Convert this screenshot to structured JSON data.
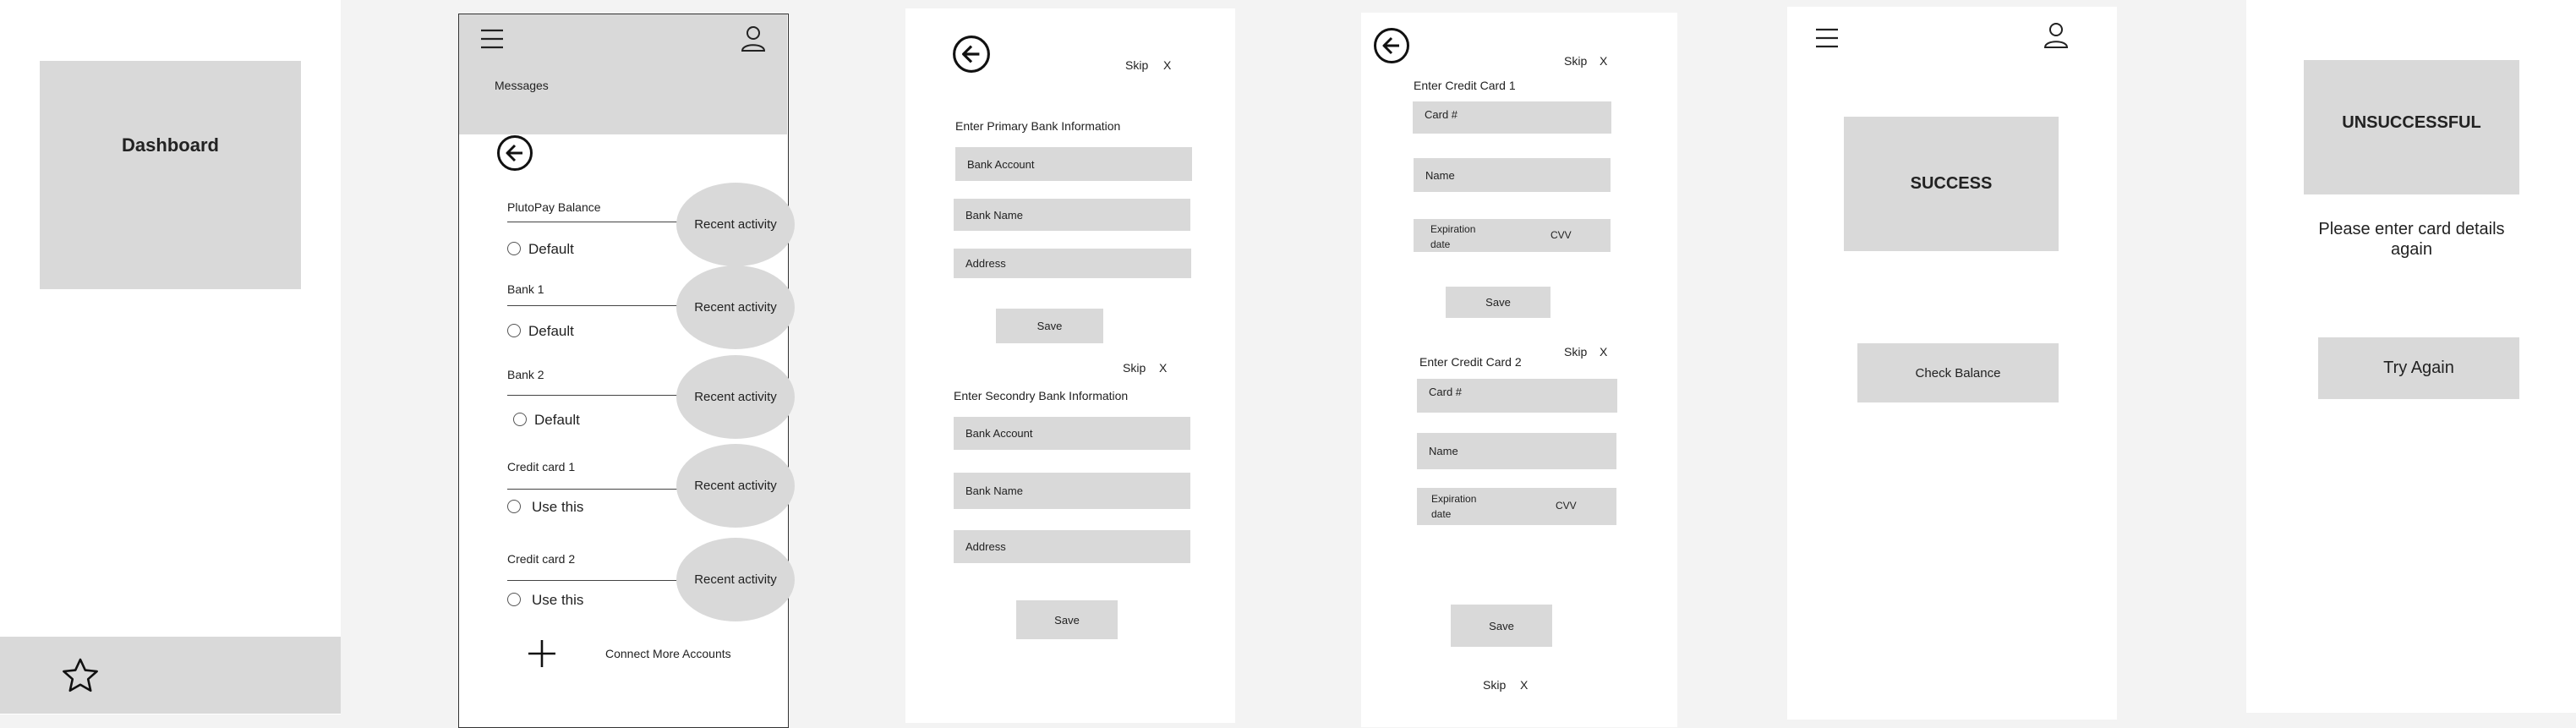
{
  "screen1": {
    "title": "Dashboard",
    "star_icon": "star-icon"
  },
  "screen2": {
    "menu_icon": "hamburger-menu-icon",
    "profile_icon": "user-icon",
    "messages": "Messages",
    "back_icon": "back-arrow-icon",
    "accounts": [
      {
        "name": "PlutoPay Balance",
        "option": "Default",
        "activity": "Recent activity"
      },
      {
        "name": "Bank 1",
        "option": "Default",
        "activity": "Recent activity"
      },
      {
        "name": "Bank 2",
        "option": "Default",
        "activity": "Recent activity"
      },
      {
        "name": "Credit card 1",
        "option": "Use this",
        "activity": "Recent activity"
      },
      {
        "name": "Credit card 2",
        "option": "Use this",
        "activity": "Recent activity"
      }
    ],
    "connect_more": "Connect More Accounts",
    "plus_icon": "plus-icon"
  },
  "screen3": {
    "skip": "Skip",
    "close": "X",
    "primary_heading": "Enter Primary Bank Information",
    "primary_fields": [
      "Bank Account",
      "Bank Name",
      "Address"
    ],
    "save": "Save",
    "secondary_heading": "Enter Secondry Bank Information",
    "secondary_fields": [
      "Bank Account",
      "Bank Name",
      "Address"
    ]
  },
  "screen4": {
    "skip": "Skip",
    "close": "X",
    "card1_heading": "Enter Credit Card 1",
    "card2_heading": "Enter Credit Card 2",
    "card_number": "Card #",
    "name": "Name",
    "expiration": "Expiration date",
    "cvv": "CVV",
    "save": "Save"
  },
  "screen5": {
    "success": "SUCCESS",
    "check_balance": "Check Balance"
  },
  "screen6": {
    "unsuccessful": "UNSUCCESSFUL",
    "message": "Please enter card details again",
    "try_again": "Try Again"
  }
}
